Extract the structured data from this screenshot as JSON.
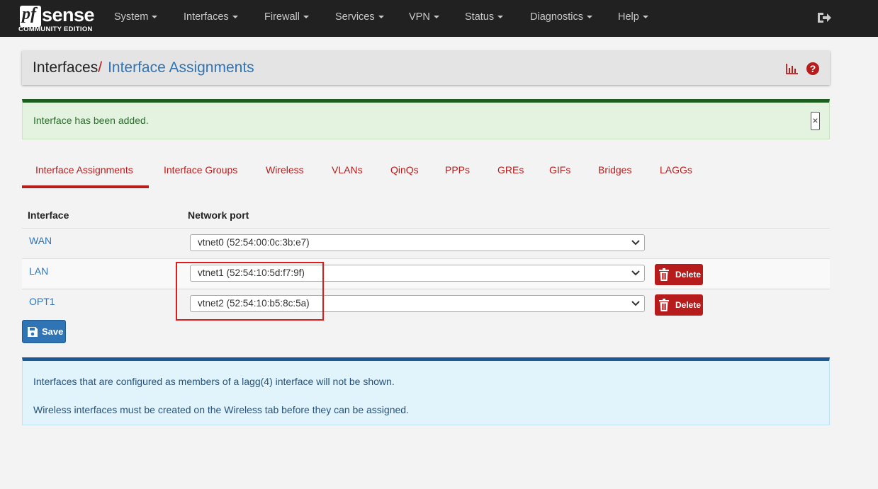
{
  "navbar": {
    "brand": {
      "pf": "pf",
      "sense": "sense",
      "edition": "COMMUNITY EDITION"
    },
    "menu": [
      "System",
      "Interfaces",
      "Firewall",
      "Services",
      "VPN",
      "Status",
      "Diagnostics",
      "Help"
    ],
    "logout_icon": "logout-icon"
  },
  "breadcrumb": {
    "parent": "Interfaces",
    "separator": "/",
    "current": "Interface Assignments",
    "icons": [
      "bar-chart-icon",
      "help-icon"
    ],
    "help_glyph": "?"
  },
  "alert_success": {
    "message": "Interface has been added.",
    "close_glyph": "×"
  },
  "tabs": {
    "items": [
      "Interface Assignments",
      "Interface Groups",
      "Wireless",
      "VLANs",
      "QinQs",
      "PPPs",
      "GREs",
      "GIFs",
      "Bridges",
      "LAGGs"
    ],
    "active": "Interface Assignments"
  },
  "table": {
    "headers": [
      "Interface",
      "Network port"
    ],
    "rows": [
      {
        "interface": "WAN",
        "port": "vtnet0 (52:54:00:0c:3b:e7)",
        "deletable": false
      },
      {
        "interface": "LAN",
        "port": "vtnet1 (52:54:10:5d:f7:9f)",
        "deletable": true
      },
      {
        "interface": "OPT1",
        "port": "vtnet2 (52:54:10:b5:8c:5a)",
        "deletable": true
      }
    ],
    "delete_label": "Delete"
  },
  "save_label": "Save",
  "info": {
    "lines": [
      "Interfaces that are configured as members of a lagg(4) interface will not be shown.",
      "Wireless interfaces must be created on the Wireless tab before they can be assigned."
    ]
  },
  "colors": {
    "navbar": "#212121",
    "accent_red": "#b71c1c",
    "link_blue": "#2f74b5",
    "success_border": "#1d5e1d",
    "info_border": "#1d5a95",
    "highlight": "#e01b1b"
  }
}
